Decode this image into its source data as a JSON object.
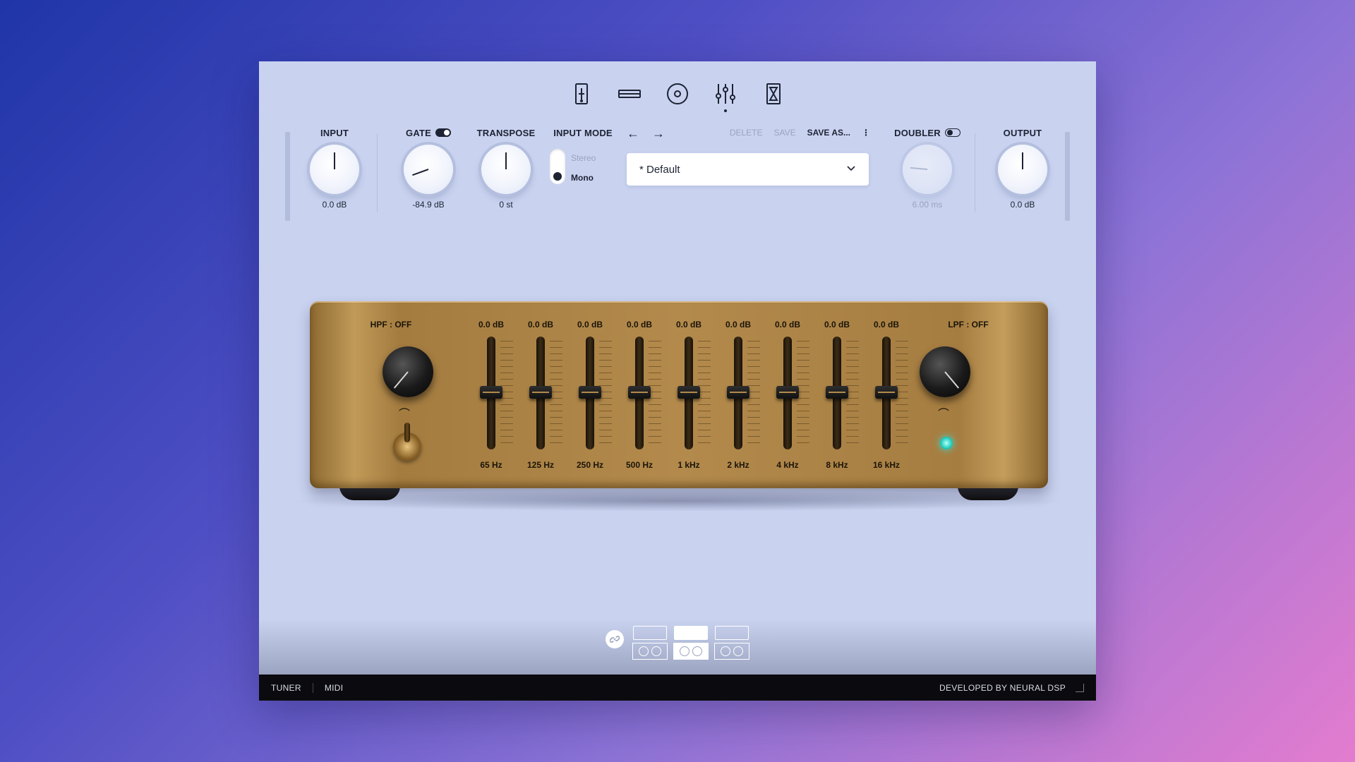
{
  "nav": {
    "items": [
      {
        "name": "pedal",
        "active": false
      },
      {
        "name": "amp",
        "active": false
      },
      {
        "name": "cabinet",
        "active": false
      },
      {
        "name": "eq",
        "active": true
      },
      {
        "name": "timer",
        "active": false
      }
    ]
  },
  "controls": {
    "input": {
      "label": "INPUT",
      "value": "0.0 dB"
    },
    "gate": {
      "label": "GATE",
      "value": "-84.9 dB",
      "enabled": true
    },
    "transpose": {
      "label": "TRANSPOSE",
      "value": "0 st"
    },
    "input_mode": {
      "label": "INPUT MODE",
      "options": [
        "Stereo",
        "Mono"
      ],
      "selected": "Mono"
    },
    "doubler": {
      "label": "DOUBLER",
      "value": "6.00 ms",
      "enabled": false
    },
    "output": {
      "label": "OUTPUT",
      "value": "0.0 dB"
    }
  },
  "preset": {
    "prev_icon": "←",
    "next_icon": "→",
    "delete_label": "DELETE",
    "save_label": "SAVE",
    "save_as_label": "SAVE AS...",
    "more_icon": "⋮",
    "current": "* Default",
    "chevron": "⌄"
  },
  "eq": {
    "hpf_label": "HPF : OFF",
    "lpf_label": "LPF : OFF",
    "bands": [
      {
        "gain": "0.0 dB",
        "freq": "65 Hz"
      },
      {
        "gain": "0.0 dB",
        "freq": "125 Hz"
      },
      {
        "gain": "0.0 dB",
        "freq": "250 Hz"
      },
      {
        "gain": "0.0 dB",
        "freq": "500 Hz"
      },
      {
        "gain": "0.0 dB",
        "freq": "1 kHz"
      },
      {
        "gain": "0.0 dB",
        "freq": "2 kHz"
      },
      {
        "gain": "0.0 dB",
        "freq": "4 kHz"
      },
      {
        "gain": "0.0 dB",
        "freq": "8 kHz"
      },
      {
        "gain": "0.0 dB",
        "freq": "16 kHz"
      }
    ],
    "led_color": "#32d6c9",
    "body_color": "#b38a4c"
  },
  "modules": [
    {
      "name": "amp-1",
      "active": false
    },
    {
      "name": "amp-2",
      "active": true
    },
    {
      "name": "amp-3",
      "active": false
    }
  ],
  "statusbar": {
    "tuner": "TUNER",
    "midi": "MIDI",
    "credit": "DEVELOPED BY NEURAL DSP"
  },
  "colors": {
    "panel": "#c9d3f0",
    "text": "#1d2333",
    "muted": "#9aa3bf",
    "statusbar": "#0b0b0f"
  }
}
